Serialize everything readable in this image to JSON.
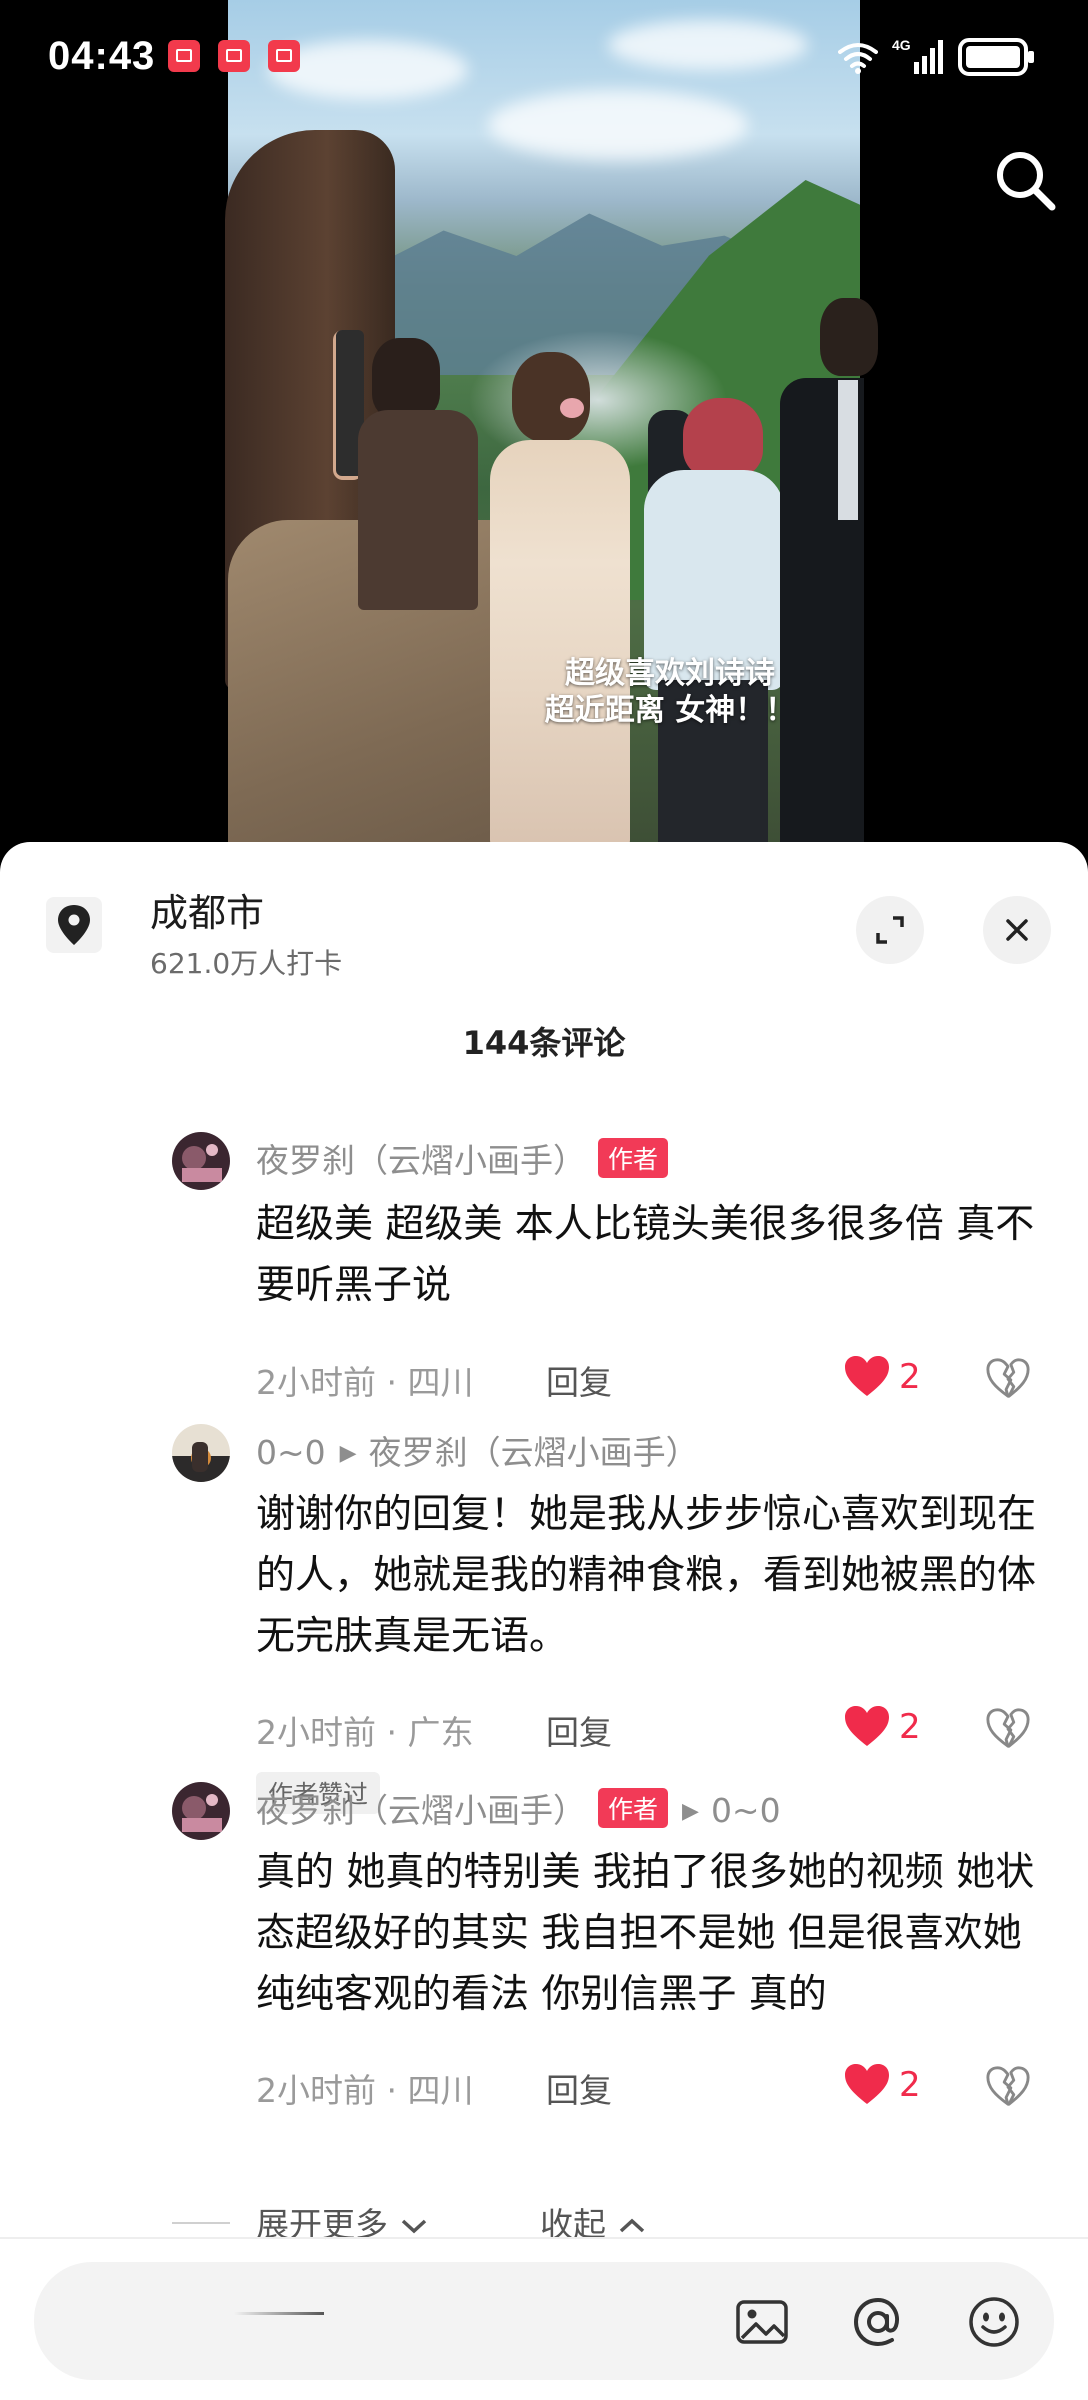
{
  "status_bar": {
    "time": "04:43",
    "network": "4G",
    "notification_icons": [
      "notification-app-icon",
      "notification-app-icon",
      "notification-app-icon"
    ]
  },
  "video": {
    "caption_line1": "超级喜欢刘诗诗",
    "caption_line2": "超近距离 女神！！"
  },
  "location": {
    "title": "成都市",
    "subtitle": "621.0万人打卡"
  },
  "comments_header": "144条评论",
  "comments": [
    {
      "name": "夜罗刹（云熠小画手）",
      "badge": "作者",
      "text": "超级美 超级美 本人比镜头美很多很多倍 真不要听黑子说",
      "time_place": "2小时前 · 四川",
      "reply_label": "回复",
      "likes": "2"
    },
    {
      "name": "0~0",
      "reply_to": "夜罗刹（云熠小画手）",
      "text": "谢谢你的回复！她是我从步步惊心喜欢到现在的人，她就是我的精神食粮，看到她被黑的体无完肤真是无语。",
      "time_place": "2小时前 · 广东",
      "reply_label": "回复",
      "likes": "2",
      "liked_by_author": "作者赞过"
    },
    {
      "name": "夜罗刹（云熠小画手）",
      "badge": "作者",
      "reply_to": "0~0",
      "text": "真的 她真的特别美 我拍了很多她的视频 她状态超级好的其实 我自担不是她 但是很喜欢她 纯纯客观的看法 你别信黑子 真的",
      "time_place": "2小时前 · 四川",
      "reply_label": "回复",
      "likes": "2"
    }
  ],
  "expand_label": "展开更多",
  "collapse_label": "收起",
  "colors": {
    "accent_red": "#f02b4b",
    "badge_red": "#f23a57"
  }
}
